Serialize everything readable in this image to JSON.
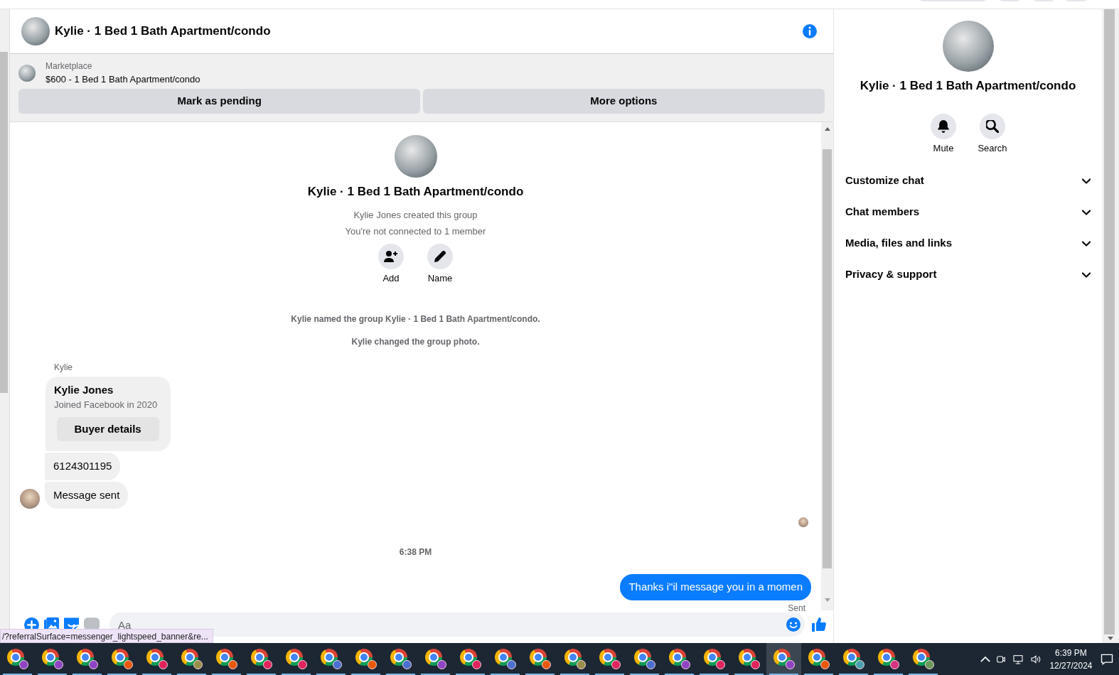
{
  "chat_header": {
    "title": "Kylie · 1 Bed 1 Bath Apartment/condo"
  },
  "listing": {
    "source": "Marketplace",
    "title": "$600 - 1 Bed 1 Bath Apartment/condo",
    "buttons": [
      "Mark as pending",
      "More options"
    ]
  },
  "group_intro": {
    "title": "Kylie · 1 Bed 1 Bath Apartment/condo",
    "lines": [
      "Kylie Jones created this group",
      "You're not connected to 1 member"
    ],
    "actions": [
      {
        "kind": "add",
        "label": "Add"
      },
      {
        "kind": "name",
        "label": "Name"
      }
    ]
  },
  "events": [
    "Kylie named the group Kylie · 1 Bed 1 Bath Apartment/condo.",
    "Kylie changed the group photo."
  ],
  "messages": [
    {
      "kind": "sender",
      "text": "Kylie"
    },
    {
      "kind": "profile_card",
      "name": "Kylie Jones",
      "subtitle": "Joined Facebook in 2020",
      "button": "Buyer details"
    },
    {
      "kind": "text",
      "text": "6124301195",
      "avatar": false
    },
    {
      "kind": "text",
      "text": "Message sent",
      "avatar": true
    },
    {
      "kind": "seen"
    },
    {
      "kind": "time",
      "text": "6:38 PM"
    },
    {
      "kind": "outgoing",
      "text": "Thanks i\"il message you in a momen"
    },
    {
      "kind": "status",
      "text": "Sent"
    }
  ],
  "composer": {
    "placeholder": "Aa",
    "tools": [
      {
        "kind": "plus"
      },
      {
        "kind": "image"
      },
      {
        "kind": "sticker"
      },
      {
        "kind": "gif"
      }
    ]
  },
  "status_url": "/?referralSurface=messenger_lightspeed_banner&re...",
  "side_panel": {
    "title": "Kylie · 1 Bed 1 Bath Apartment/condo",
    "actions": [
      {
        "kind": "mute",
        "label": "Mute"
      },
      {
        "kind": "search",
        "label": "Search"
      }
    ],
    "sections": [
      {
        "label": "Customize chat",
        "expanded": false
      },
      {
        "label": "Chat members",
        "expanded": false
      },
      {
        "label": "Media, files and links",
        "expanded": false
      },
      {
        "label": "Privacy & support",
        "expanded": false
      }
    ]
  },
  "taskbar": {
    "apps": [
      {
        "color": "#8e44c4",
        "selected": false
      },
      {
        "color": "#8e44c4",
        "selected": false
      },
      {
        "color": "#8e44c4",
        "selected": false
      },
      {
        "color": "#e8590c",
        "selected": false
      },
      {
        "color": "#e0245e",
        "selected": false
      },
      {
        "color": "#9a8f4a",
        "selected": false
      },
      {
        "color": "#e8590c",
        "selected": false
      },
      {
        "color": "#e0245e",
        "selected": false
      },
      {
        "color": "#e0245e",
        "selected": false
      },
      {
        "color": "#4a6fd0",
        "selected": false
      },
      {
        "color": "#e8590c",
        "selected": false
      },
      {
        "color": "#4a6fd0",
        "selected": false
      },
      {
        "color": "#8e44c4",
        "selected": false
      },
      {
        "color": "#e0245e",
        "selected": false
      },
      {
        "color": "#4a6fd0",
        "selected": false
      },
      {
        "color": "#e8590c",
        "selected": false
      },
      {
        "color": "#9a8f4a",
        "selected": false
      },
      {
        "color": "#e0245e",
        "selected": false
      },
      {
        "color": "#4a6fd0",
        "selected": false
      },
      {
        "color": "#8e44c4",
        "selected": false
      },
      {
        "color": "#e0245e",
        "selected": false
      },
      {
        "color": "#e0245e",
        "selected": false
      },
      {
        "color": "#8e44c4",
        "selected": true
      },
      {
        "color": "#e8590c",
        "selected": false
      },
      {
        "color": "#4aa0b0",
        "selected": false
      },
      {
        "color": "#d63384",
        "selected": false
      },
      {
        "color": "#6a9a5a",
        "selected": false
      }
    ],
    "time": "6:39 PM",
    "date": "12/27/2024"
  }
}
